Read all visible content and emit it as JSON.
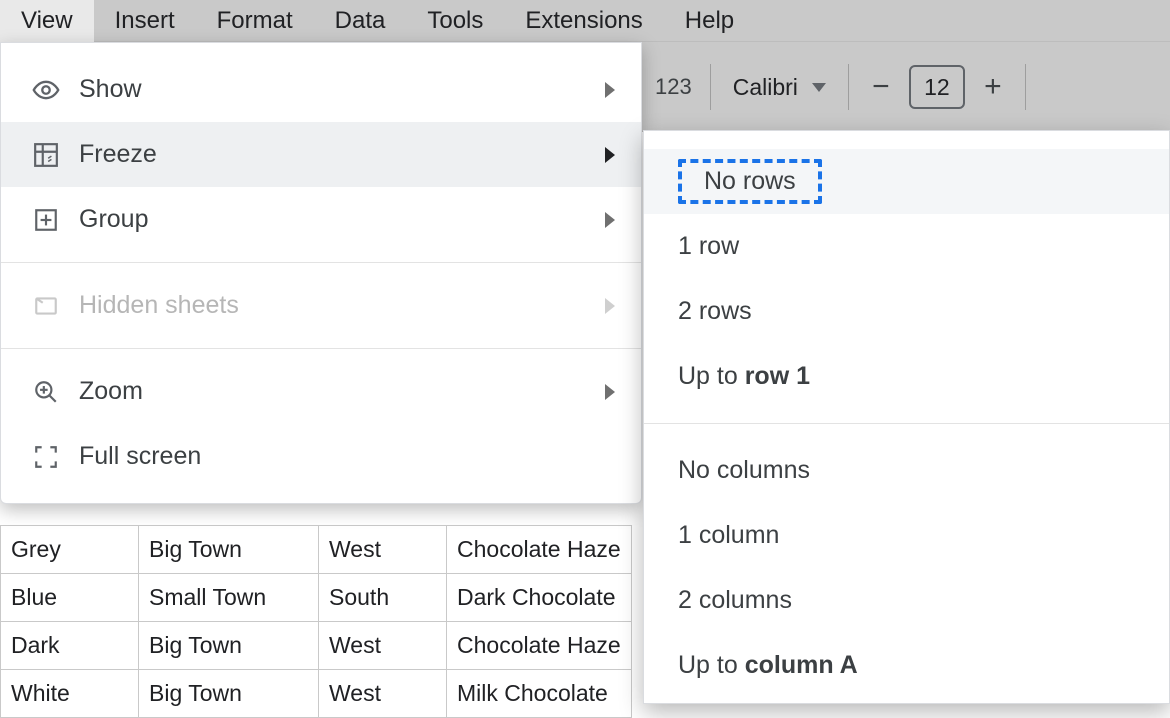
{
  "menubar": {
    "items": [
      "View",
      "Insert",
      "Format",
      "Data",
      "Tools",
      "Extensions",
      "Help"
    ],
    "active_index": 0
  },
  "toolbar": {
    "number_format_label": "123",
    "font_name": "Calibri",
    "font_size": "12"
  },
  "view_menu": {
    "items": [
      {
        "label": "Show",
        "icon": "eye-icon",
        "has_submenu": true,
        "disabled": false
      },
      {
        "label": "Freeze",
        "icon": "freeze-icon",
        "has_submenu": true,
        "disabled": false,
        "hovered": true
      },
      {
        "label": "Group",
        "icon": "plus-box-icon",
        "has_submenu": true,
        "disabled": false
      },
      {
        "divider": true
      },
      {
        "label": "Hidden sheets",
        "icon": "sheet-icon",
        "has_submenu": true,
        "disabled": true
      },
      {
        "divider": true
      },
      {
        "label": "Zoom",
        "icon": "zoom-icon",
        "has_submenu": true,
        "disabled": false
      },
      {
        "label": "Full screen",
        "icon": "fullscreen-icon",
        "has_submenu": false,
        "disabled": false
      }
    ]
  },
  "freeze_submenu": {
    "items": [
      {
        "label_plain": "No rows",
        "highlighted": true
      },
      {
        "label_plain": "1 row"
      },
      {
        "label_plain": "2 rows"
      },
      {
        "label_prefix": "Up to ",
        "label_bold": "row 1"
      },
      {
        "divider": true
      },
      {
        "label_plain": "No columns"
      },
      {
        "label_plain": "1 column"
      },
      {
        "label_plain": "2 columns"
      },
      {
        "label_prefix": "Up to ",
        "label_bold": "column A"
      }
    ]
  },
  "sheet_rows": [
    [
      "Grey",
      "Big Town",
      "West",
      "Chocolate Haze"
    ],
    [
      "Blue",
      "Small Town",
      "South",
      "Dark Chocolate"
    ],
    [
      "Dark",
      "Big Town",
      "West",
      "Chocolate Haze"
    ],
    [
      "White",
      "Big Town",
      "West",
      "Milk Chocolate"
    ]
  ]
}
